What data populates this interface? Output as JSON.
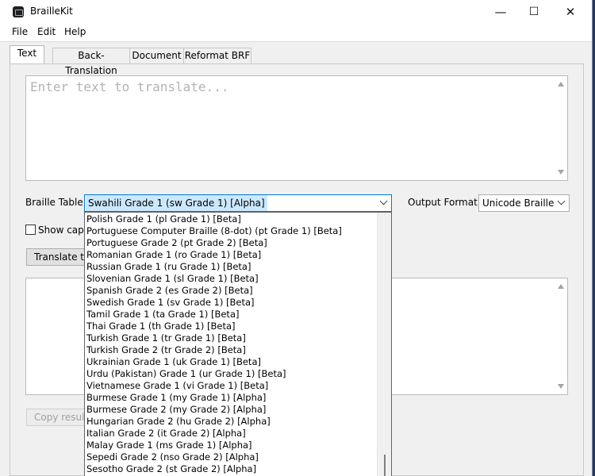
{
  "window": {
    "title": "BrailleKit",
    "minimize": "—",
    "maximize": "☐",
    "close": "✕"
  },
  "menu": [
    "File",
    "Edit",
    "Help"
  ],
  "tabs": [
    "Text",
    "Back-Translation",
    "Document",
    "Reformat BRF"
  ],
  "input": {
    "placeholder": "Enter text to translate..."
  },
  "braille_table": {
    "label": "Braille Table:",
    "selected": "Swahili Grade 1 (sw Grade 1) [Alpha]",
    "options": [
      "Polish Grade 1 (pl Grade 1) [Beta]",
      "Portuguese Computer Braille (8-dot) (pt Grade 1) [Beta]",
      "Portuguese Grade 2 (pt Grade 2) [Beta]",
      "Romanian Grade 1 (ro Grade 1) [Beta]",
      "Russian Grade 1 (ru Grade 1) [Beta]",
      "Slovenian Grade 1 (sl Grade 1) [Beta]",
      "Spanish Grade 2 (es Grade 2) [Beta]",
      "Swedish Grade 1 (sv Grade 1) [Beta]",
      "Tamil Grade 1 (ta Grade 1) [Beta]",
      "Thai Grade 1 (th Grade 1) [Beta]",
      "Turkish Grade 1 (tr Grade 1) [Beta]",
      "Turkish Grade 2 (tr Grade 2) [Beta]",
      "Ukrainian Grade 1 (uk Grade 1) [Beta]",
      "Urdu (Pakistan) Grade 1 (ur Grade 1) [Beta]",
      "Vietnamese Grade 1 (vi Grade 1) [Beta]",
      "Burmese Grade 1 (my Grade 1) [Alpha]",
      "Burmese Grade 2 (my Grade 2) [Alpha]",
      "Hungarian Grade 2 (hu Grade 2) [Alpha]",
      "Italian Grade 2 (it Grade 2) [Alpha]",
      "Malay Grade 1 (ms Grade 1) [Alpha]",
      "Sepedi Grade 2 (nso Grade 2) [Alpha]",
      "Sesotho Grade 2 (st Grade 2) [Alpha]"
    ]
  },
  "output_format": {
    "label": "Output Format:",
    "selected": "Unicode Braille"
  },
  "show_capitals": {
    "label": "Show capit",
    "checked": false
  },
  "translate_button": "Translate tex",
  "copy_button": "Copy result"
}
